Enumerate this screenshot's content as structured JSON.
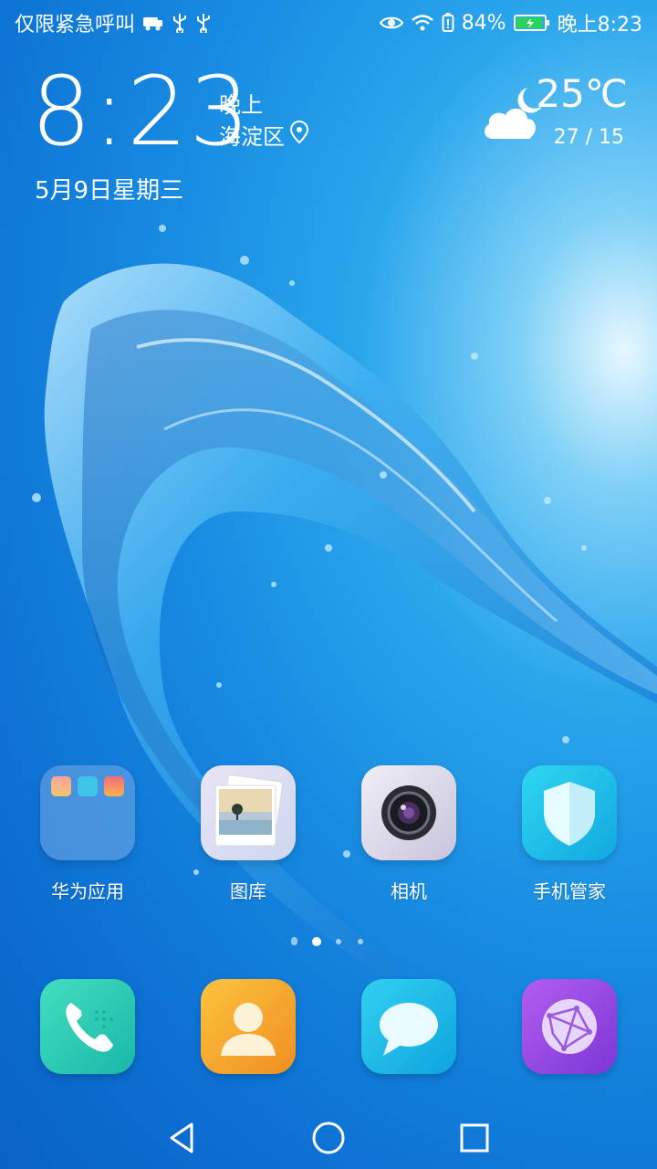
{
  "status_bar": {
    "left_text": "仅限紧急呼叫",
    "left_icons": [
      "car-mode-icon",
      "usb-icon",
      "usb-icon"
    ],
    "right_icons": [
      "eye-comfort-icon",
      "wifi-icon",
      "battery-saver-icon"
    ],
    "battery_percent": "84%",
    "time": "晚上8:23"
  },
  "clock": {
    "time": "8:23",
    "period": "晚上",
    "location": "海淀区",
    "date": "5月9日星期三"
  },
  "weather": {
    "icon": "cloudy-night-icon",
    "temperature": "25℃",
    "range": "27 / 15"
  },
  "apps": [
    {
      "label": "华为应用",
      "icon": "folder-icon"
    },
    {
      "label": "图库",
      "icon": "gallery-icon"
    },
    {
      "label": "相机",
      "icon": "camera-icon"
    },
    {
      "label": "手机管家",
      "icon": "phone-manager-icon"
    }
  ],
  "pages": {
    "current": 2,
    "total": 4
  },
  "dock": [
    {
      "icon": "phone-icon",
      "color": "#2ccfb3"
    },
    {
      "icon": "contacts-icon",
      "color": "#f5a524"
    },
    {
      "icon": "messages-icon",
      "color": "#17b8e8"
    },
    {
      "icon": "browser-icon",
      "color": "#9a4ee8"
    }
  ],
  "navigation": [
    "back-icon",
    "home-icon",
    "recents-icon"
  ]
}
